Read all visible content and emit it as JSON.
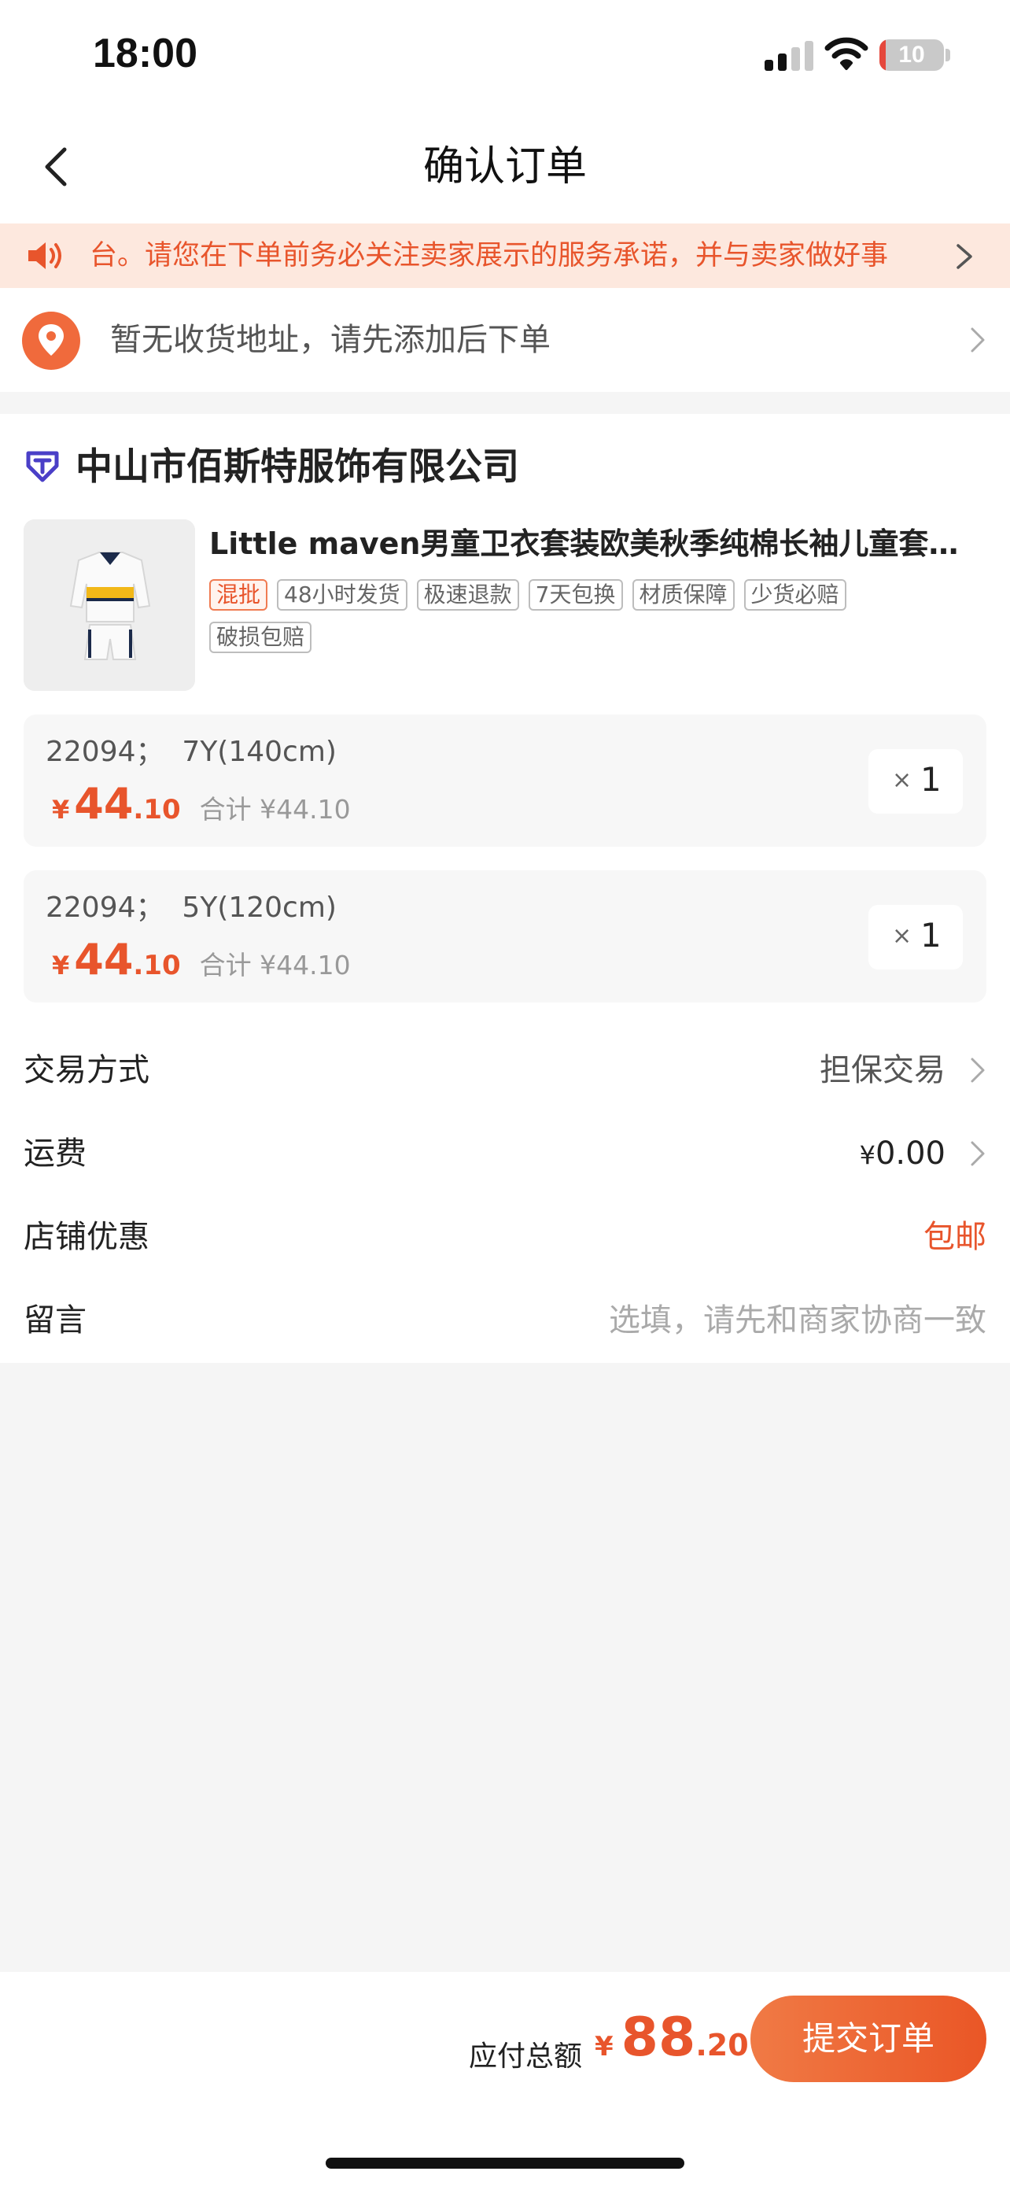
{
  "status_bar": {
    "time": "18:00",
    "battery": "10",
    "battery_level": 0.1,
    "signal_bars": 2
  },
  "nav": {
    "title": "确认订单",
    "back_icon": "chevron-left-icon"
  },
  "notice": {
    "text": "台。请您在下单前务必关注卖家展示的服务承诺，并与卖家做好事",
    "icon": "speaker-icon"
  },
  "address": {
    "text": "暂无收货地址，请先添加后下单",
    "icon": "location-pin-icon"
  },
  "shop": {
    "name": "中山市佰斯特服饰有限公司",
    "icon": "shop-badge-icon"
  },
  "product": {
    "title": "Little maven男童卫衣套装欧美秋季纯棉长袖儿童套装...",
    "tags": [
      "混批",
      "48小时发货",
      "极速退款",
      "7天包换",
      "材质保障",
      "少货必赔",
      "破损包赔"
    ]
  },
  "skus": [
    {
      "spec": "22094；  7Y(140cm)",
      "price_yen": "¥",
      "price_int": "44",
      "price_dec": ".10",
      "subtotal": "合计 ¥44.10",
      "qty_x": "×",
      "qty": "1"
    },
    {
      "spec": "22094；  5Y(120cm)",
      "price_yen": "¥",
      "price_int": "44",
      "price_dec": ".10",
      "subtotal": "合计 ¥44.10",
      "qty_x": "×",
      "qty": "1"
    }
  ],
  "order_info": {
    "trade_label": "交易方式",
    "trade_value": "担保交易",
    "shipping_label": "运费",
    "shipping_yen": "¥",
    "shipping_value": "0.00",
    "promo_label": "店铺优惠",
    "promo_value": "包邮",
    "note_label": "留言",
    "note_placeholder": "选填，请先和商家协商一致"
  },
  "bottom": {
    "total_label": "应付总额",
    "total_yen": "¥",
    "total_int": "88",
    "total_dec": ".20",
    "submit_label": "提交订单"
  },
  "colors": {
    "accent": "#e8552c",
    "notice_bg": "#fde8de",
    "page_bg": "#f5f5f5",
    "shop_icon": "#4a3fc7"
  }
}
